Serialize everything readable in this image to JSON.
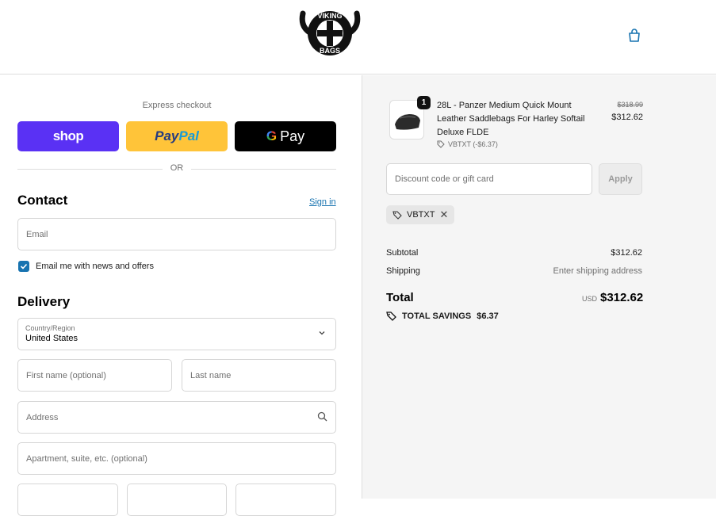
{
  "header": {
    "logo_top": "VIKING",
    "logo_bottom": "BAGS"
  },
  "express": {
    "title": "Express checkout",
    "shop_label": "shop",
    "paypal_part1": "Pay",
    "paypal_part2": "Pal",
    "gpay_g": "G",
    "gpay_label": "Pay",
    "or_label": "OR"
  },
  "contact": {
    "title": "Contact",
    "signin_label": "Sign in",
    "email_placeholder": "Email",
    "newsletter_label": "Email me with news and offers",
    "newsletter_checked": true
  },
  "delivery": {
    "title": "Delivery",
    "country_label": "Country/Region",
    "country_value": "United States",
    "first_name_placeholder": "First name (optional)",
    "last_name_placeholder": "Last name",
    "address_placeholder": "Address",
    "apartment_placeholder": "Apartment, suite, etc. (optional)"
  },
  "order": {
    "quantity": "1",
    "product_name": "28L - Panzer Medium Quick Mount Leather Saddlebags For Harley Softail Deluxe FLDE",
    "product_discount": "VBTXT (-$6.37)",
    "old_price": "$318.99",
    "new_price": "$312.62"
  },
  "discount": {
    "placeholder": "Discount code or gift card",
    "apply_label": "Apply",
    "applied_code": "VBTXT",
    "remove_symbol": "✕"
  },
  "summary": {
    "subtotal_label": "Subtotal",
    "subtotal_value": "$312.62",
    "shipping_label": "Shipping",
    "shipping_value": "Enter shipping address",
    "total_label": "Total",
    "total_currency": "USD",
    "total_value": "$312.62",
    "savings_label": "TOTAL SAVINGS",
    "savings_value": "$6.37"
  },
  "colors": {
    "accent": "#1773b0",
    "shop": "#5a31f4",
    "paypal": "#ffc439",
    "gpay": "#000000",
    "sidebar_bg": "#f5f5f5"
  }
}
